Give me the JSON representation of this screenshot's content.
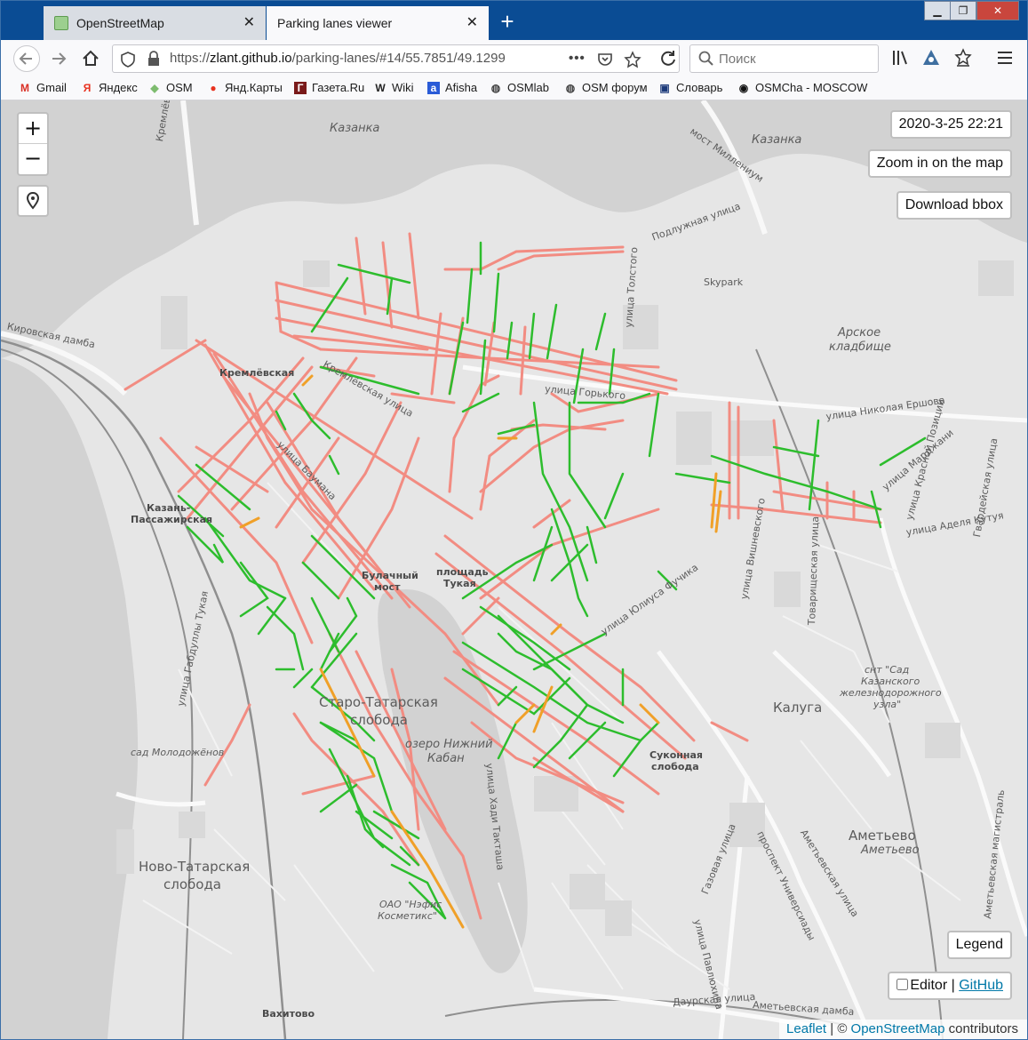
{
  "browser": {
    "tabs": [
      {
        "title": "OpenStreetMap",
        "active": false
      },
      {
        "title": "Parking lanes viewer",
        "active": true
      }
    ],
    "new_tab_symbol": "+",
    "close_symbol": "✕",
    "url_prefix": "https://",
    "url_domain": "zlant.github.io",
    "url_path": "/parking-lanes/#14/55.7851/49.1299",
    "url_more": "•••",
    "search_placeholder": "Поиск",
    "window_controls": {
      "minimize": "▁",
      "maximize": "❐",
      "close": "✕"
    }
  },
  "bookmarks": [
    {
      "label": "Gmail",
      "icon": "M",
      "color": "#d93025"
    },
    {
      "label": "Яндекс",
      "icon": "Я",
      "color": "#e8321f"
    },
    {
      "label": "OSM",
      "icon": "◆",
      "color": "#7ebc6f"
    },
    {
      "label": "Янд.Карты",
      "icon": "●",
      "color": "#e8321f"
    },
    {
      "label": "Газета.Ru",
      "icon": "Г",
      "color": "#7a1a1a"
    },
    {
      "label": "Wiki",
      "icon": "W",
      "color": "#222222"
    },
    {
      "label": "Afisha",
      "icon": "a",
      "color": "#2a5bd7"
    },
    {
      "label": "OSMlab",
      "icon": "◍",
      "color": "#444444"
    },
    {
      "label": "OSM форум",
      "icon": "◍",
      "color": "#444444"
    },
    {
      "label": "Словарь",
      "icon": "▣",
      "color": "#1c3a7a"
    },
    {
      "label": "OSMCha - MOSCOW",
      "icon": "◉",
      "color": "#111111"
    }
  ],
  "map": {
    "zoom_in": "+",
    "zoom_out": "−",
    "datetime": "2020-3-25 22:21",
    "zoom_hint": "Zoom in on the map",
    "download_button": "Download bbox",
    "legend_button": "Legend",
    "editor_label": "Editor",
    "editor_separator": " | ",
    "github_link": "GitHub",
    "attribution": {
      "leaflet": "Leaflet",
      "sep": " | © ",
      "osm": "OpenStreetMap",
      "suffix": " contributors"
    },
    "colors": {
      "no_parking": "#f28c82",
      "parking": "#2dbd2d",
      "conditional": "#f0a028",
      "water": "#d2d2d2",
      "land": "#e6e6e6"
    },
    "labels": {
      "kazanka1": "Казанка",
      "kazanka2": "Казанка",
      "kremlin_dam": "Кремлёвская дамба",
      "kirov_dam": "Кировская дамба",
      "millennium": "мост Миллениум",
      "podluzhnaya": "Подлужная улица",
      "skypark": "Skypark",
      "tolstogo": "улица Толстого",
      "arskoe1": "Арское",
      "arskoe2": "кладбище",
      "kremlevskaya_st": "Кремлёвская",
      "kremlevskaya_ul": "Кремлёвская улица",
      "baumana": "улица Баумана",
      "gorkogo": "улица Горького",
      "ershova": "улица Николая Ершова",
      "marjani": "улица Марджани",
      "krasnoi_pozicii": "улица Красной Позиции",
      "gvardeiskaya": "Гвардейская улица",
      "kutuya": "улица Аделя Кутуя",
      "passenger1": "Казань-",
      "passenger2": "Пассажирская",
      "bulachny1": "Булачный",
      "bulachny2": "мост",
      "tukaya1": "площадь",
      "tukaya2": "Тукая",
      "fuchika": "улица Юлиуса Фучика",
      "vishnevskogo": "улица Вишневского",
      "tovarishcheskaya": "Товарищеская улица",
      "gabdully": "улица Габдуллы Тукая",
      "kaluga": "Калуга",
      "snt1": "снт \"Сад",
      "snt2": "Казанского",
      "snt3": "железнодорожного",
      "snt4": "узла\"",
      "staro1": "Старо-Татарская",
      "staro2": "слобода",
      "kaban1": "озеро Нижний",
      "kaban2": "Кабан",
      "sukonnaya1": "Суконная",
      "sukonnaya2": "слобода",
      "molodozhenov": "сад Молодожёнов",
      "khady": "улица Хади Такташа",
      "gazovaya": "Газовая улица",
      "universitet": "проспект Универсиады",
      "ametevskaya": "Аметьевская улица",
      "ametevo1": "Аметьево",
      "ametevo2": "Аметьево",
      "magistral": "Аметьевская магистраль",
      "novo1": "Ново-Татарская",
      "novo2": "слобода",
      "nafis1": "ОАО \"Нэфис",
      "nafis2": "Косметикс\"",
      "pavlyukhina": "улица Павлюхина",
      "daurskaya": "Даурская улица",
      "ametevskaya_dam": "Аметьевская дамба",
      "vakhitovo": "Вахитово"
    }
  }
}
